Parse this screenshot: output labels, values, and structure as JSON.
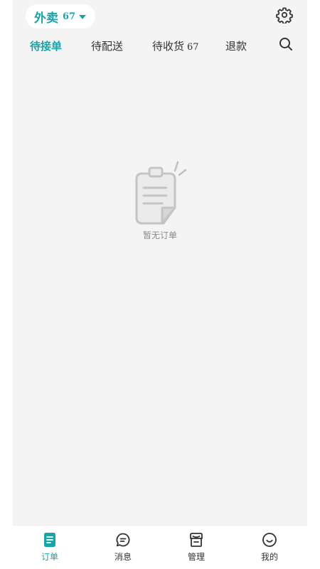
{
  "header": {
    "store_name": "外卖",
    "store_count": "67",
    "settings_icon": "gear-icon"
  },
  "tabs": [
    {
      "label": "待接单",
      "count": "",
      "active": true
    },
    {
      "label": "待配送",
      "count": "",
      "active": false
    },
    {
      "label": "待收货",
      "count": "67",
      "active": false
    },
    {
      "label": "退款",
      "count": "",
      "active": false
    }
  ],
  "search_icon": "search-icon",
  "empty_state": {
    "text": "暂无订单",
    "icon": "clipboard-icon"
  },
  "bottom_nav": [
    {
      "label": "订单",
      "icon": "order-icon",
      "active": true
    },
    {
      "label": "消息",
      "icon": "message-icon",
      "active": false
    },
    {
      "label": "管理",
      "icon": "store-icon",
      "active": false
    },
    {
      "label": "我的",
      "icon": "profile-icon",
      "active": false
    }
  ],
  "colors": {
    "accent": "#1ba3a8",
    "background": "#f4f4f4",
    "text": "#333333",
    "muted": "#8a8a8a"
  }
}
